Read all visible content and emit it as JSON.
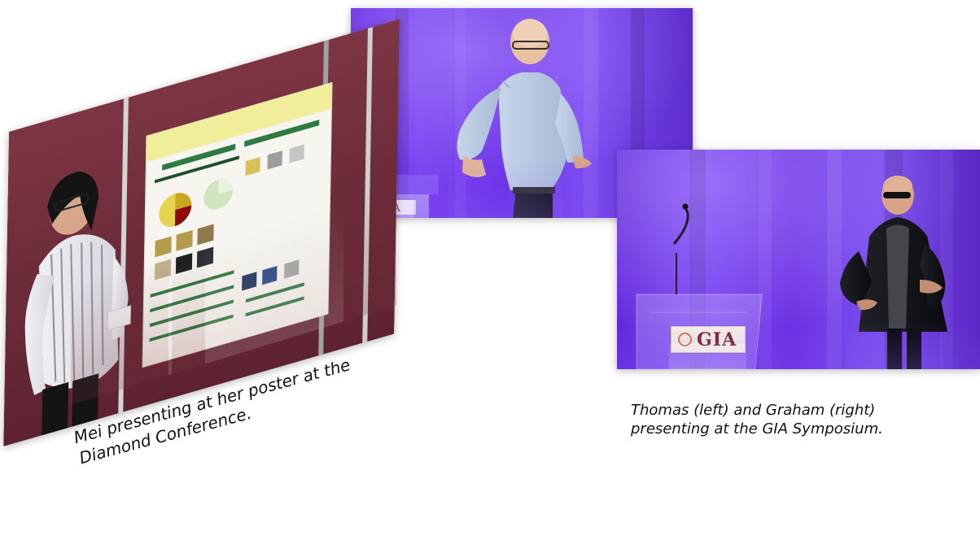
{
  "captions": {
    "mei": [
      "Mei presenting at her poster at the",
      "Diamond Conference."
    ],
    "symposium": [
      "Thomas (left) and Graham (right)",
      "presenting at the GIA Symposium."
    ]
  },
  "colors": {
    "poster_wall": "#6b2a36",
    "stage_purple": "#6f35e7",
    "caption_text": "#111111"
  },
  "images": {
    "poster_scene": {
      "subject": "poster-scene-photo"
    },
    "thomas_scene": {
      "subject": "stage-presentation-photo"
    },
    "graham_scene": {
      "subject": "stage-presentation-photo"
    }
  }
}
